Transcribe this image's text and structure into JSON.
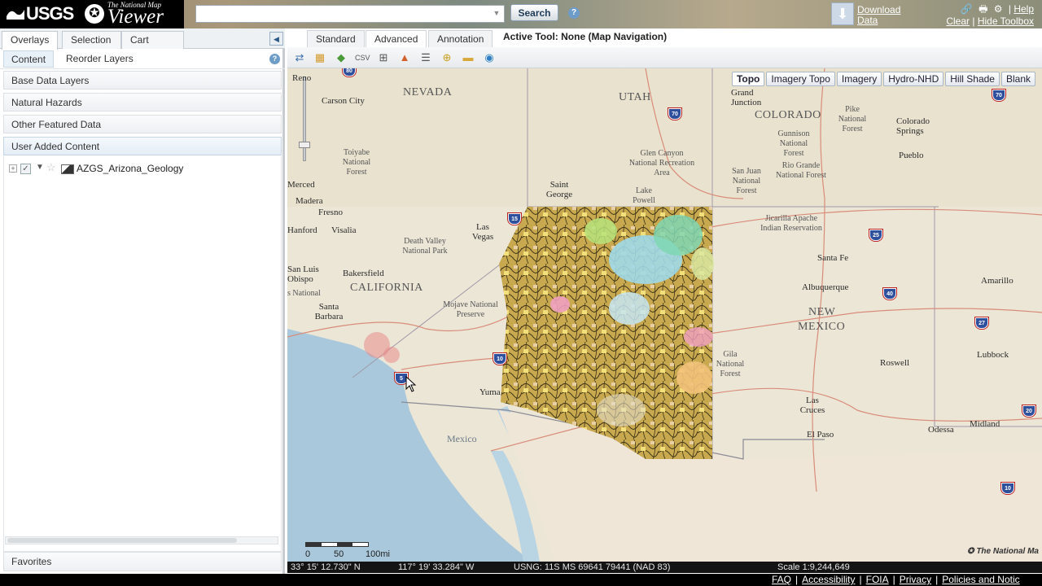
{
  "header": {
    "logo_agency": "USGS",
    "logo_tagline": "The National Map",
    "logo_product": "Viewer",
    "search_value": "",
    "search_button": "Search",
    "download_line1": "Download",
    "download_line2": "Data",
    "help_link": "Help",
    "clear_link": "Clear",
    "hide_toolbox_link": "Hide Toolbox"
  },
  "left_panel": {
    "tabs": [
      {
        "label": "Overlays",
        "active": true
      },
      {
        "label": "Selection",
        "active": false
      },
      {
        "label": "Cart",
        "active": false
      }
    ],
    "subtabs": [
      {
        "label": "Content",
        "active": true
      },
      {
        "label": "Reorder Layers",
        "active": false
      }
    ],
    "sections": [
      "Base Data Layers",
      "Natural Hazards",
      "Other Featured Data",
      "User Added Content"
    ],
    "layer_name": "AZGS_Arizona_Geology",
    "favorites": "Favorites"
  },
  "toolbar": {
    "tabs": [
      {
        "label": "Standard",
        "active": false
      },
      {
        "label": "Advanced",
        "active": true
      },
      {
        "label": "Annotation",
        "active": false
      }
    ],
    "active_tool": "Active Tool: None (Map Navigation)",
    "icons": [
      "identify-icon",
      "select-icon",
      "measure-icon",
      "coordinates-icon",
      "print-icon",
      "shapes-icon",
      "layers-icon",
      "locate-icon",
      "markup-icon",
      "globe-icon"
    ]
  },
  "map": {
    "basemaps": [
      {
        "label": "Topo",
        "active": true
      },
      {
        "label": "Imagery Topo",
        "active": false
      },
      {
        "label": "Imagery",
        "active": false
      },
      {
        "label": "Hydro-NHD",
        "active": false
      },
      {
        "label": "Hill Shade",
        "active": false
      },
      {
        "label": "Blank",
        "active": false
      }
    ],
    "labels": {
      "nevada": "NEVADA",
      "utah": "UTAH",
      "colorado": "COLORADO",
      "california": "CALIFORNIA",
      "new_mexico_1": "NEW",
      "new_mexico_2": "MEXICO",
      "mexico": "Mexico",
      "carson_city": "Carson City",
      "reno": "Reno",
      "merced": "Merced",
      "madera": "Madera",
      "fresno": "Fresno",
      "visalia": "Visalia",
      "hanford": "Hanford",
      "bakersfield": "Bakersfield",
      "san_luis_obispo": "San Luis Obispo",
      "santa_barbara": "Santa Barbara",
      "las_vegas": "Las Vegas",
      "saint_george": "Saint George",
      "grand_junction": "Grand Junction",
      "colorado_springs": "Colorado Springs",
      "pueblo": "Pueblo",
      "santa_fe": "Santa Fe",
      "albuquerque": "Albuquerque",
      "amarillo": "Amarillo",
      "lubbock": "Lubbock",
      "roswell": "Roswell",
      "las_cruces": "Las Cruces",
      "el_paso": "El Paso",
      "odessa": "Odessa",
      "midland": "Midland",
      "yuma": "Yuma",
      "toiyabe": "Toiyabe National Forest",
      "death_valley": "Death Valley National Park",
      "mojave": "Mojave National Preserve",
      "glen_canyon": "Glen Canyon National Recreation Area",
      "lake_powell": "Lake Powell",
      "san_juan": "San Juan National Forest",
      "gunnison": "Gunnison National Forest",
      "rio_grande": "Rio Grande National Forest",
      "pike": "Pike National Forest",
      "jicarilla": "Jicarilla Apache Indian Reservation",
      "gila": "Gila National Forest",
      "los_padres": "s National"
    },
    "shields": [
      "80",
      "70",
      "15",
      "25",
      "40",
      "27",
      "10",
      "5",
      "70",
      "20",
      "10"
    ],
    "scale_ticks": [
      "0",
      "50",
      "100mi"
    ],
    "attribution": "The National Ma"
  },
  "status": {
    "lat": "33° 15' 12.730\" N",
    "lon": "117° 19' 33.284\" W",
    "usng": "USNG: 11S MS 69641 79441 (NAD 83)",
    "scale": "Scale 1:9,244,649"
  },
  "footer": {
    "links": [
      "FAQ",
      "Accessibility",
      "FOIA",
      "Privacy",
      "Policies and Notic"
    ]
  },
  "colors": {
    "header_bg": "#8a7d64",
    "logo_bg": "#000000",
    "accent_blue": "#2c5a85",
    "map_land": "#efe9dc",
    "ocean": "#a9c8dc",
    "footer_bg": "#000000"
  }
}
